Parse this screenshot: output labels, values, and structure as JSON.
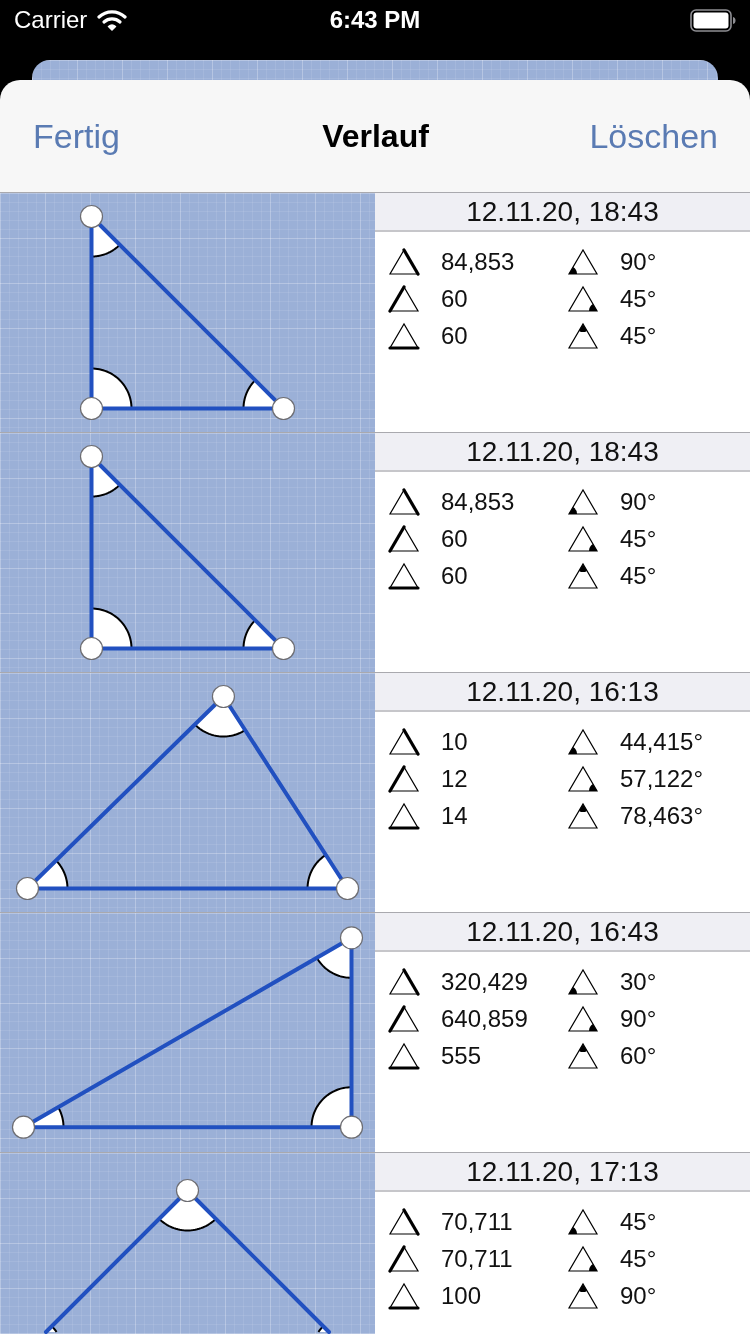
{
  "status_bar": {
    "carrier": "Carrier",
    "time": "6:43 PM"
  },
  "nav_bar": {
    "left_button": "Fertig",
    "title": "Verlauf",
    "right_button": "Löschen"
  },
  "entries": [
    {
      "date": "12.11.20, 18:43",
      "sides": [
        {
          "kind": "right",
          "value": "84,853"
        },
        {
          "kind": "left",
          "value": "60"
        },
        {
          "kind": "bottom",
          "value": "60"
        }
      ],
      "angles": [
        {
          "kind": "left",
          "value": "90°"
        },
        {
          "kind": "right",
          "value": "45°"
        },
        {
          "kind": "top",
          "value": "45°"
        }
      ]
    },
    {
      "date": "12.11.20, 18:43",
      "sides": [
        {
          "kind": "right",
          "value": "84,853"
        },
        {
          "kind": "left",
          "value": "60"
        },
        {
          "kind": "bottom",
          "value": "60"
        }
      ],
      "angles": [
        {
          "kind": "left",
          "value": "90°"
        },
        {
          "kind": "right",
          "value": "45°"
        },
        {
          "kind": "top",
          "value": "45°"
        }
      ]
    },
    {
      "date": "12.11.20, 16:13",
      "sides": [
        {
          "kind": "right",
          "value": "10"
        },
        {
          "kind": "left",
          "value": "12"
        },
        {
          "kind": "bottom",
          "value": "14"
        }
      ],
      "angles": [
        {
          "kind": "left",
          "value": "44,415°"
        },
        {
          "kind": "right",
          "value": "57,122°"
        },
        {
          "kind": "top",
          "value": "78,463°"
        }
      ]
    },
    {
      "date": "12.11.20, 16:43",
      "sides": [
        {
          "kind": "right",
          "value": "320,429"
        },
        {
          "kind": "left",
          "value": "640,859"
        },
        {
          "kind": "bottom",
          "value": "555"
        }
      ],
      "angles": [
        {
          "kind": "left",
          "value": "30°"
        },
        {
          "kind": "right",
          "value": "90°"
        },
        {
          "kind": "top",
          "value": "60°"
        }
      ]
    },
    {
      "date": "12.11.20, 17:13",
      "sides": [
        {
          "kind": "right",
          "value": "70,711"
        },
        {
          "kind": "left",
          "value": "70,711"
        },
        {
          "kind": "bottom",
          "value": "100"
        }
      ],
      "angles": [
        {
          "kind": "left",
          "value": "45°"
        },
        {
          "kind": "right",
          "value": "45°"
        },
        {
          "kind": "top",
          "value": "90°"
        }
      ]
    }
  ]
}
